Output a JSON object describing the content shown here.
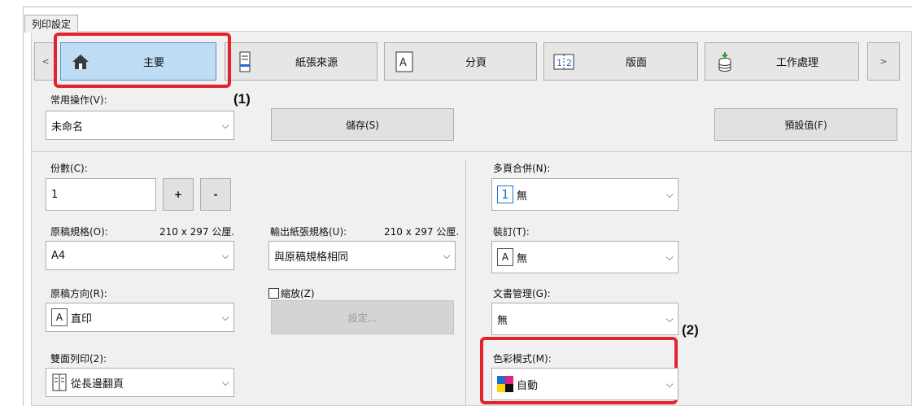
{
  "window": {
    "page_tab_label": "列印設定"
  },
  "tabs": {
    "scroll_left": "<",
    "scroll_right": ">",
    "items": [
      {
        "label": "主要",
        "icon": "home-icon",
        "selected": true
      },
      {
        "label": "紙張來源",
        "icon": "paper-stack-icon",
        "selected": false
      },
      {
        "label": "分頁",
        "icon": "single-page-icon",
        "selected": false
      },
      {
        "label": "版面",
        "icon": "two-up-layout-icon",
        "selected": false
      },
      {
        "label": "工作處理",
        "icon": "job-storage-icon",
        "selected": false
      }
    ]
  },
  "favorites": {
    "label": "常用操作(V):",
    "value": "未命名",
    "save_button": "儲存(S)",
    "defaults_button": "預設值(F)"
  },
  "copies": {
    "label": "份數(C):",
    "value": "1",
    "plus": "+",
    "minus": "-"
  },
  "original_size": {
    "label": "原稿規格(O):",
    "dimension": "210 x 297 公厘.",
    "value": "A4"
  },
  "output_size": {
    "label": "輸出紙張規格(U):",
    "dimension": "210 x 297 公厘.",
    "value": "與原稿規格相同"
  },
  "orientation": {
    "label": "原稿方向(R):",
    "value": "直印",
    "icon_glyph": "A"
  },
  "zoom": {
    "label": "縮放(Z)",
    "checked": false,
    "settings_button": "設定..."
  },
  "duplex": {
    "label": "雙面列印(2):",
    "value": "從長邊翻頁"
  },
  "nup": {
    "label": "多頁合併(N):",
    "value": "無",
    "icon_glyph": "1"
  },
  "binding": {
    "label": "裝訂(T):",
    "value": "無",
    "icon_glyph": "A"
  },
  "document_filing": {
    "label": "文書管理(G):",
    "value": "無"
  },
  "color_mode": {
    "label": "色彩模式(M):",
    "value": "自動"
  },
  "callouts": {
    "one": "(1)",
    "two": "(2)"
  },
  "colors": {
    "callout": "#e3222c",
    "selected_tab": "#bfdcf5",
    "accent_blue": "#1f6fd1"
  }
}
